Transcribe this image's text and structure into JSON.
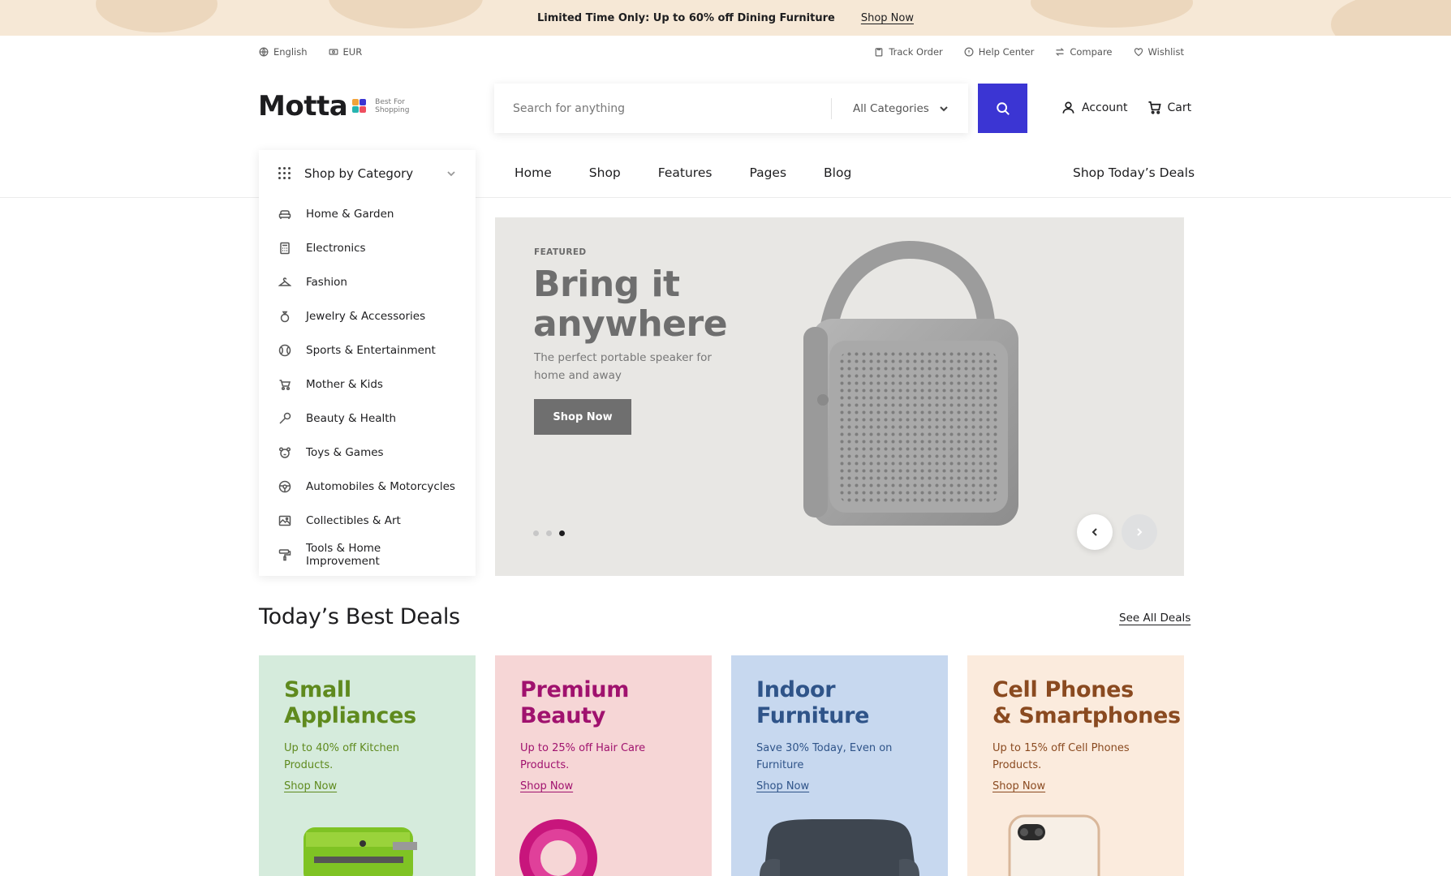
{
  "promo": {
    "text": "Limited Time Only: Up to 60% off Dining Furniture",
    "link": "Shop Now"
  },
  "utility": {
    "language": "English",
    "currency": "EUR",
    "track_order": "Track Order",
    "help_center": "Help Center",
    "compare": "Compare",
    "wishlist": "Wishlist"
  },
  "logo": {
    "name": "Motta",
    "tagline_1": "Best For",
    "tagline_2": "Shopping"
  },
  "search": {
    "placeholder": "Search for anything",
    "category": "All Categories"
  },
  "header": {
    "account": "Account",
    "cart": "Cart"
  },
  "categories": {
    "heading": "Shop by Category",
    "items": [
      {
        "label": "Home & Garden",
        "icon": "sofa-icon"
      },
      {
        "label": "Electronics",
        "icon": "calculator-icon"
      },
      {
        "label": "Fashion",
        "icon": "hanger-icon"
      },
      {
        "label": "Jewelry & Accessories",
        "icon": "ring-icon"
      },
      {
        "label": "Sports & Entertainment",
        "icon": "ball-icon"
      },
      {
        "label": "Mother & Kids",
        "icon": "stroller-icon"
      },
      {
        "label": "Beauty & Health",
        "icon": "brush-icon"
      },
      {
        "label": "Toys & Games",
        "icon": "teddy-icon"
      },
      {
        "label": "Automobiles & Motorcycles",
        "icon": "steering-wheel-icon"
      },
      {
        "label": "Collectibles & Art",
        "icon": "picture-icon"
      },
      {
        "label": "Tools & Home Improvement",
        "icon": "paint-roller-icon"
      }
    ]
  },
  "nav": {
    "items": [
      "Home",
      "Shop",
      "Features",
      "Pages",
      "Blog"
    ],
    "deals": "Shop Today’s Deals"
  },
  "hero": {
    "eyebrow": "FEATURED",
    "title": "Bring it anywhere",
    "subtitle": "The perfect portable speaker for home and away",
    "button": "Shop Now",
    "slide_count": 3,
    "active_slide": 3
  },
  "deals": {
    "title": "Today’s Best Deals",
    "see_all": "See All Deals",
    "cards": [
      {
        "title_1": "Small",
        "title_2": "Appliances",
        "desc": "Up to 40% off Kitchen Products.",
        "link": "Shop Now",
        "bg": "#d5ebdc",
        "accent": "#5f8a1e"
      },
      {
        "title_1": "Premium",
        "title_2": "Beauty",
        "desc": "Up to 25% off Hair Care Products.",
        "link": "Shop Now",
        "bg": "#f6d6d6",
        "accent": "#a0126e"
      },
      {
        "title_1": "Indoor",
        "title_2": "Furniture",
        "desc": "Save 30% Today, Even on Furniture",
        "link": "Shop Now",
        "bg": "#c7d8ef",
        "accent": "#2f5489"
      },
      {
        "title_1": "Cell Phones",
        "title_2": "& Smartphones",
        "desc": "Up to 15% off Cell Phones Products.",
        "link": "Shop Now",
        "bg": "#fbebdd",
        "accent": "#8a4a20"
      }
    ]
  },
  "colors": {
    "accent": "#3b35d3",
    "promo_bg": "#f6e8d6",
    "hero_bg": "#e8e7e4"
  }
}
